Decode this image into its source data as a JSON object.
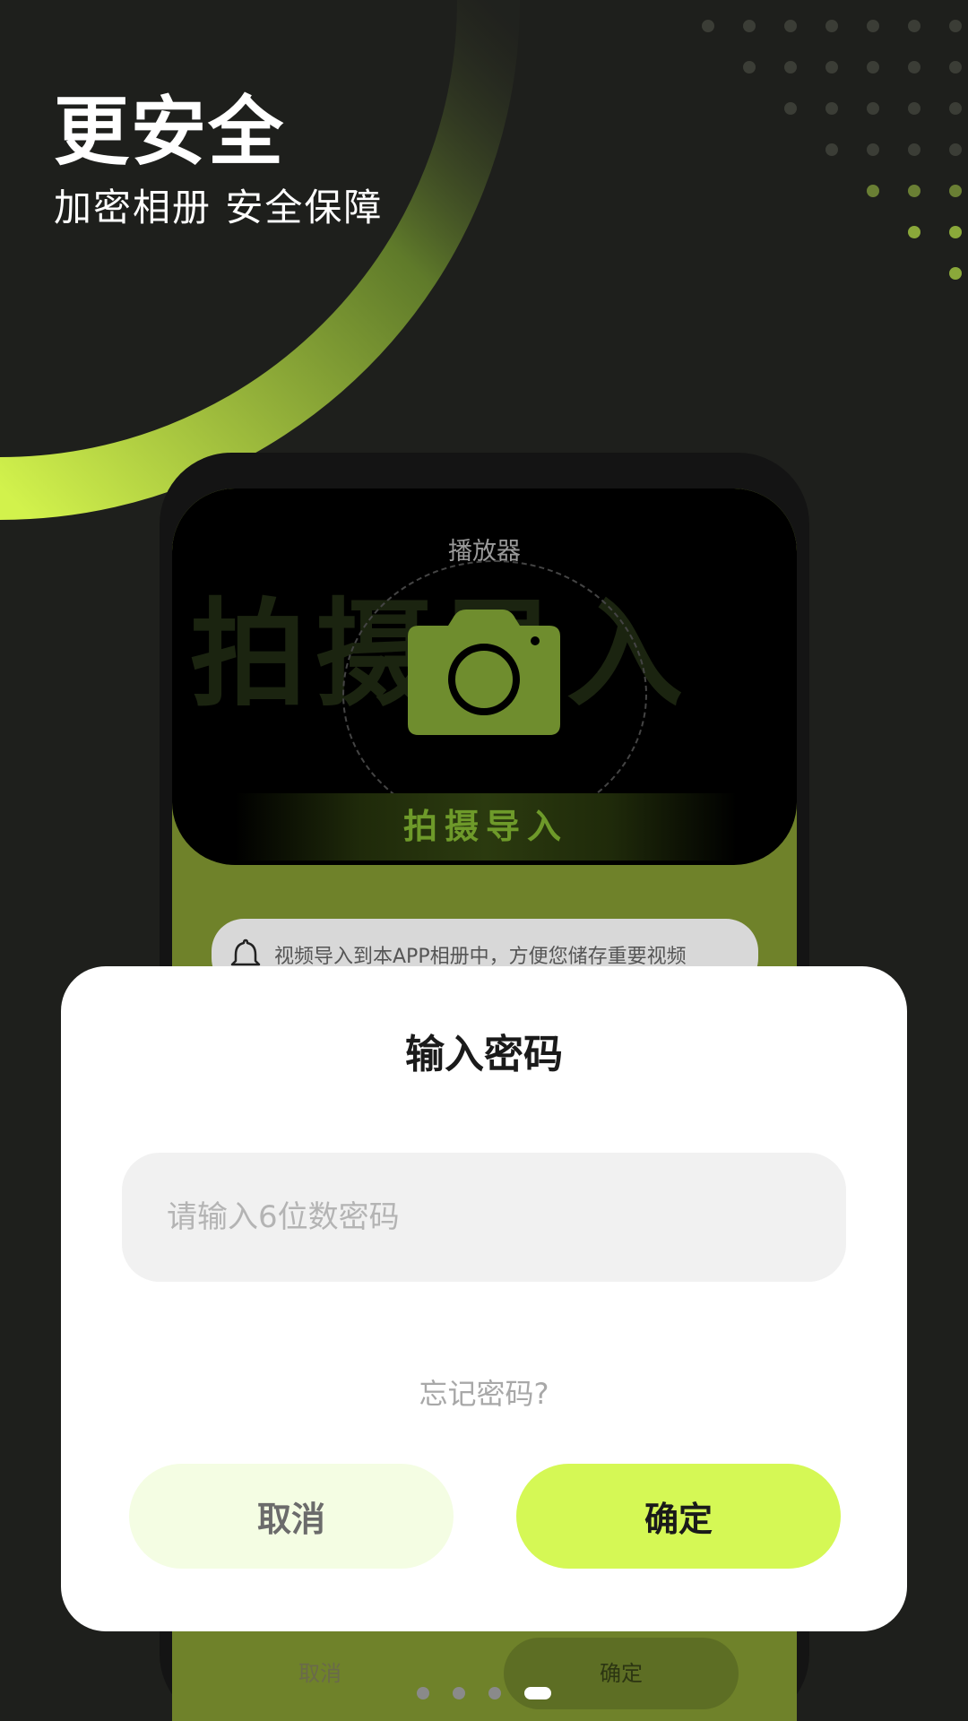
{
  "hero": {
    "title": "更安全",
    "subtitle": "加密相册 安全保障"
  },
  "mockup": {
    "player_title": "播放器",
    "watermark_text": "拍摄导入",
    "import_label": "拍摄导入",
    "notice_text": "视频导入到本APP相册中，方便您储存重要视频",
    "ghost_cancel": "取消",
    "ghost_ok": "确定"
  },
  "dialog": {
    "title": "输入密码",
    "input_placeholder": "请输入6位数密码",
    "input_value": "",
    "forgot_label": "忘记密码?",
    "cancel_label": "取消",
    "confirm_label": "确定"
  },
  "pager": {
    "count": 4,
    "active_index": 3
  },
  "colors": {
    "background": "#1e1f1c",
    "accent": "#d5f855",
    "accent_light": "#f4fde3",
    "dialog_bg": "#ffffff",
    "input_bg": "#f1f1f1",
    "phone_green": "#6f822a"
  },
  "icons": [
    "camera-icon",
    "bell-icon"
  ]
}
